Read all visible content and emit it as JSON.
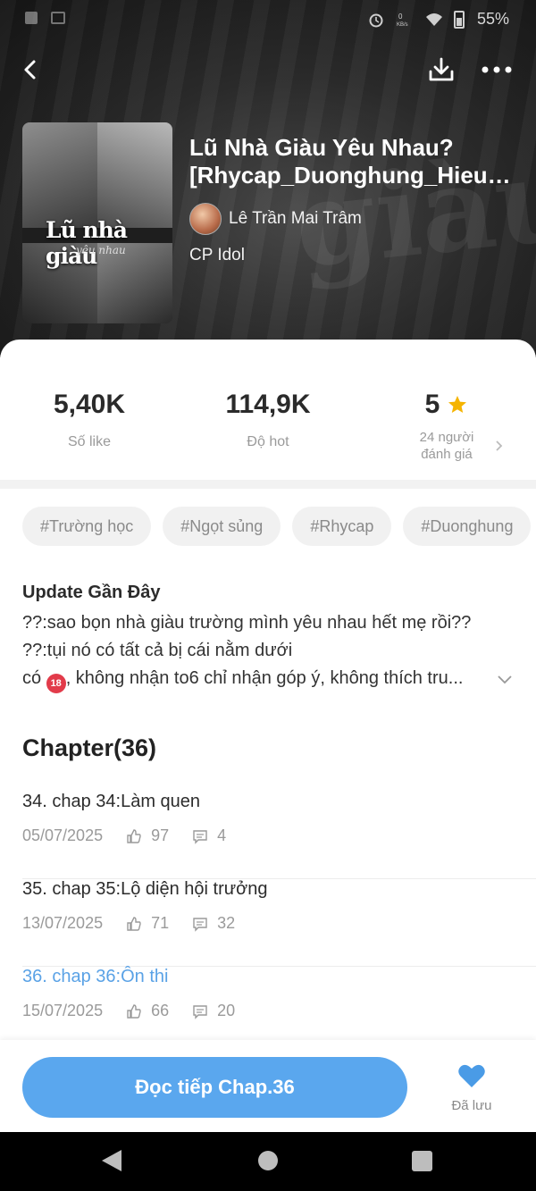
{
  "status_bar": {
    "battery": "55%"
  },
  "header": {
    "cover_text": "Lũ nhà giàu",
    "cover_subtext": "yêu nhau",
    "title_line1": "Lũ Nhà Giàu Yêu Nhau?",
    "title_line2": "[Rhycap_Duonghung_HieuA...",
    "author": "Lê Trần Mai Trâm",
    "category": "CP Idol"
  },
  "stats": {
    "likes_value": "5,40K",
    "likes_label": "Số like",
    "hot_value": "114,9K",
    "hot_label": "Độ hot",
    "rating_value": "5",
    "rating_line1": "24 người",
    "rating_line2": "đánh giá"
  },
  "tags": [
    "#Trường học",
    "#Ngọt sủng",
    "#Rhycap",
    "#Duonghung"
  ],
  "update": {
    "title": "Update Gần Đây",
    "line1": "??:sao bọn nhà giàu trường mình yêu nhau hết mẹ rồi??",
    "line2": "??:tụi nó có tất cả bị cái nằm dưới",
    "line3_prefix": "có ",
    "badge": "18",
    "line3_suffix": ", không nhận to6 chỉ nhận góp ý, không thích tru..."
  },
  "chapters": {
    "title": "Chapter(36)",
    "items": [
      {
        "title": "34. chap 34:Làm quen",
        "date": "05/07/2025",
        "likes": "97",
        "comments": "4"
      },
      {
        "title": "35. chap 35:Lộ diện hội trưởng",
        "date": "13/07/2025",
        "likes": "71",
        "comments": "32"
      },
      {
        "title": "36. chap 36:Ôn thi",
        "date": "15/07/2025",
        "likes": "66",
        "comments": "20"
      }
    ]
  },
  "actions": {
    "read_label": "Đọc tiếp Chap.36",
    "saved_label": "Đã lưu"
  },
  "colors": {
    "accent": "#5aa7ee",
    "heart": "#4a9be6",
    "star": "#f5b400",
    "active_chapter": "#5aa2e6"
  }
}
